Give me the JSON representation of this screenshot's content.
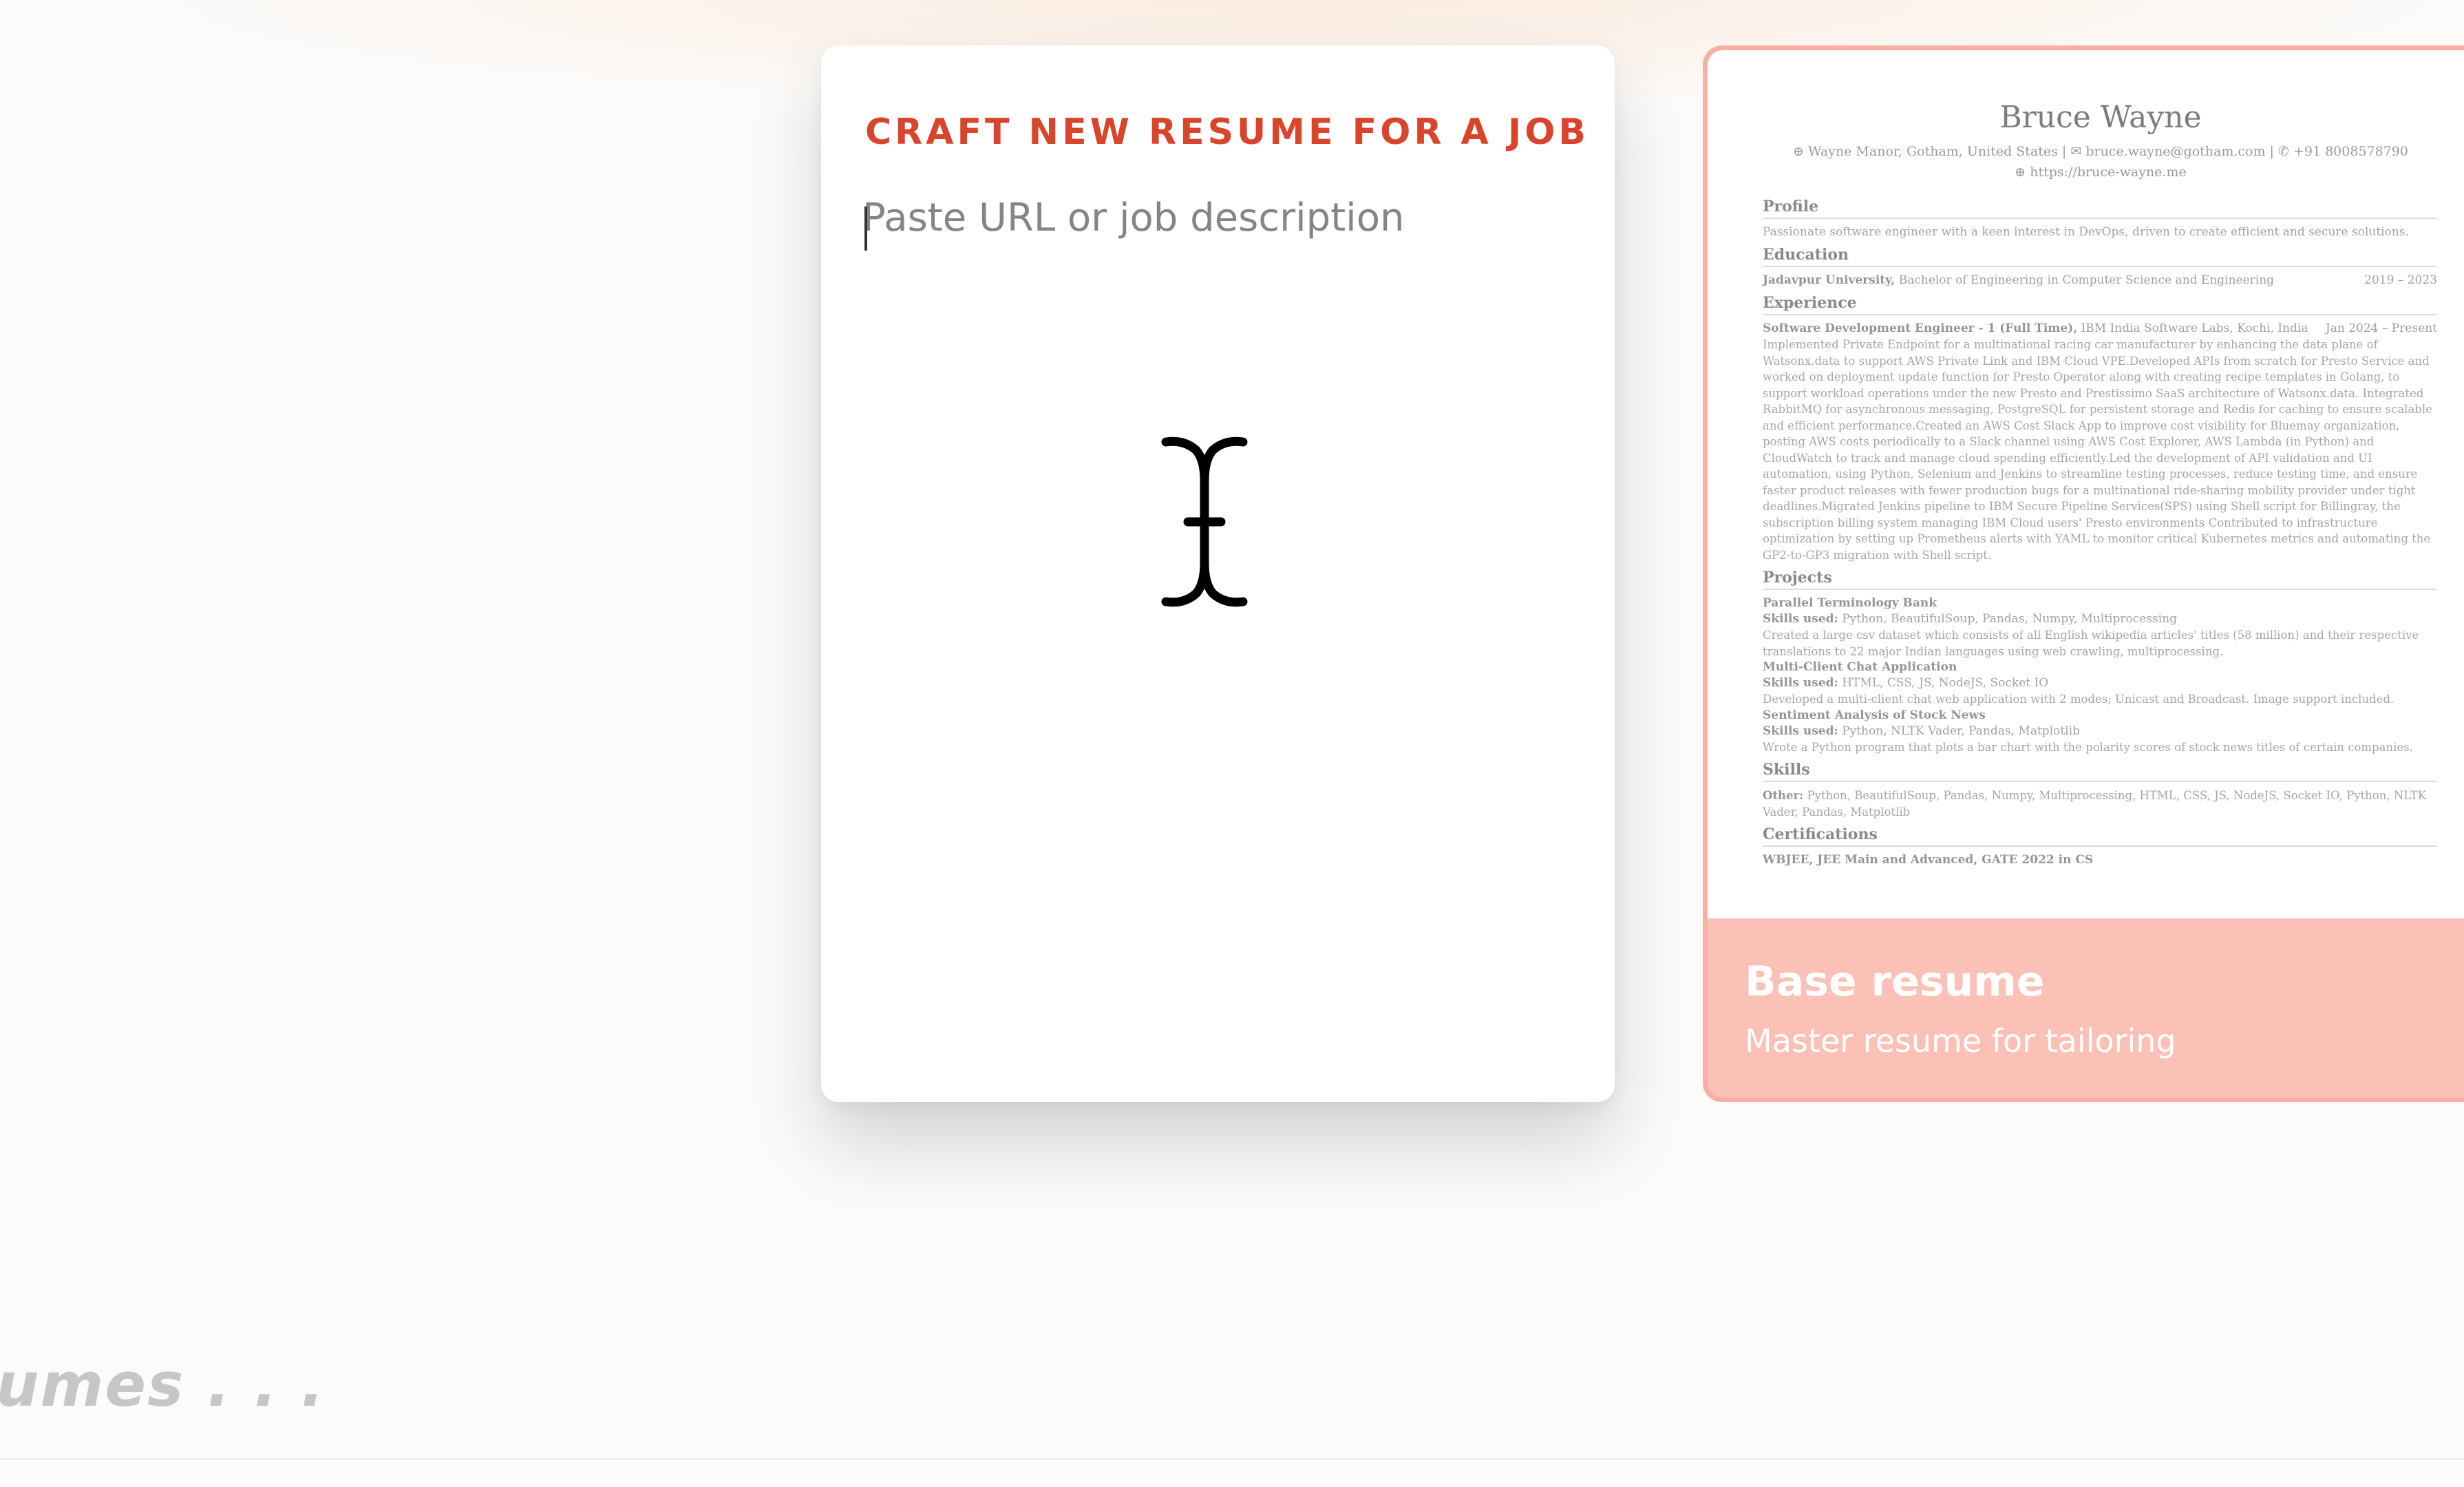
{
  "craft_card": {
    "title": "CRAFT NEW RESUME FOR A JOB",
    "input_placeholder": "Paste URL or job description",
    "input_value": ""
  },
  "base_card": {
    "title": "Base resume",
    "subtitle": "Master resume for tailoring",
    "preview": {
      "name": "Bruce Wayne",
      "contact_line": "⊕ Wayne Manor, Gotham, United States  |  ✉ bruce.wayne@gotham.com  |  ✆ +91 8008578790",
      "website": "⊕ https://bruce-wayne.me",
      "profile_heading": "Profile",
      "profile_text": "Passionate software engineer with a keen interest in DevOps, driven to create efficient and secure solutions.",
      "education_heading": "Education",
      "education_school": "Jadavpur University,",
      "education_degree": " Bachelor of Engineering in Computer Science and Engineering",
      "education_dates": "2019 – 2023",
      "experience_heading": "Experience",
      "experience_role": "Software Development Engineer - 1 (Full Time),",
      "experience_company": " IBM India Software Labs, Kochi, India",
      "experience_dates": "Jan 2024 – Present",
      "experience_text": "Implemented Private Endpoint for a multinational racing car manufacturer by enhancing the data plane of Watsonx.data to support AWS Private Link and IBM Cloud VPE.Developed APIs from scratch for Presto Service and worked on deployment update function for Presto Operator along with creating recipe templates in Golang, to support workload operations under the new Presto and Prestissimo SaaS architecture of Watsonx.data. Integrated RabbitMQ for asynchronous messaging, PostgreSQL for persistent storage and Redis for caching to ensure scalable and efficient performance.Created an AWS Cost Slack App to improve cost visibility for Bluemay organization, posting AWS costs periodically to a Slack channel using AWS Cost Explorer, AWS Lambda (in Python) and CloudWatch to track and manage cloud spending efficiently.Led the development of API validation and UI automation, using Python, Selenium and Jenkins to streamline testing processes, reduce testing time, and ensure faster product releases with fewer production bugs for a multinational ride-sharing mobility provider under tight deadlines.Migrated Jenkins pipeline to IBM Secure Pipeline Services(SPS) using Shell script for Billingray, the subscription billing system managing IBM Cloud users' Presto environments Contributed to infrastructure optimization by setting up Prometheus alerts with YAML to monitor critical Kubernetes metrics and automating the GP2-to-GP3 migration with Shell script.",
      "projects_heading": "Projects",
      "project1_name": "Parallel Terminology Bank",
      "project1_skills_label": "Skills used:",
      "project1_skills": " Python, BeautifulSoup, Pandas, Numpy, Multiprocessing",
      "project1_text": "Created a large csv dataset which consists of all English wikipedia articles' titles (58 million) and their respective translations to 22 major Indian languages using web crawling, multiprocessing.",
      "project2_name": "Multi-Client Chat Application",
      "project2_skills_label": "Skills used:",
      "project2_skills": " HTML, CSS, JS, NodeJS, Socket IO",
      "project2_text": "Developed a multi-client chat web application with 2 modes; Unicast and Broadcast. Image support included.",
      "project3_name": "Sentiment Analysis of Stock News",
      "project3_skills_label": "Skills used:",
      "project3_skills": " Python, NLTK Vader, Pandas, Matplotlib",
      "project3_text": "Wrote a Python program that plots a bar chart with the polarity scores of stock news titles of certain companies.",
      "skills_heading": "Skills",
      "skills_label": "Other:",
      "skills_text": " Python, BeautifulSoup, Pandas, Numpy, Multiprocessing, HTML, CSS, JS, NodeJS, Socket IO, Python, NLTK Vader, Pandas, Matplotlib",
      "certifications_heading": "Certifications",
      "certifications_text": "WBJEE, JEE Main and Advanced, GATE 2022 in CS"
    }
  },
  "section_label": "umes . . .",
  "colors": {
    "accent": "#d9452a",
    "base_card_bg": "#fbc1b6",
    "background": "#fcfbfa"
  },
  "icons": {
    "cursor": "text-cursor-icon"
  }
}
